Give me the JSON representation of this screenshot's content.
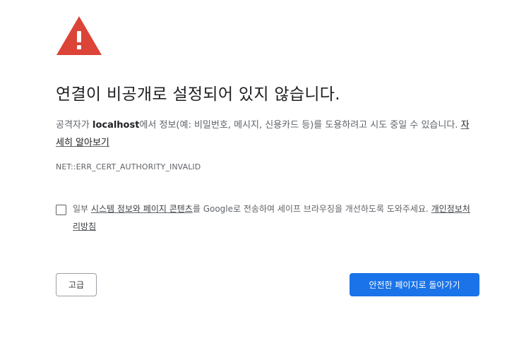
{
  "icon": {
    "name": "warning-triangle-icon",
    "color": "#db4437"
  },
  "headline": "연결이 비공개로 설정되어 있지 않습니다.",
  "message": {
    "prefix": "공격자가 ",
    "host": "localhost",
    "suffix": "에서 정보(예: 비밀번호, 메시지, 신용카드 등)를 도용하려고 시도 중일 수 있습니다. ",
    "learn_more": "자세히 알아보기"
  },
  "error_code": "NET::ERR_CERT_AUTHORITY_INVALID",
  "optin": {
    "checked": false,
    "text_prefix": "일부 ",
    "link_system_info": "시스템 정보와 페이지 콘텐츠",
    "text_middle": "를 Google로 전송하여 세이프 브라우징을 개선하도록 도와주세요. ",
    "link_privacy": "개인정보처리방침"
  },
  "buttons": {
    "advanced": "고급",
    "back_to_safety": "안전한 페이지로 돌아가기"
  },
  "colors": {
    "primary_button": "#1a73e8",
    "warning_red": "#db4437"
  }
}
